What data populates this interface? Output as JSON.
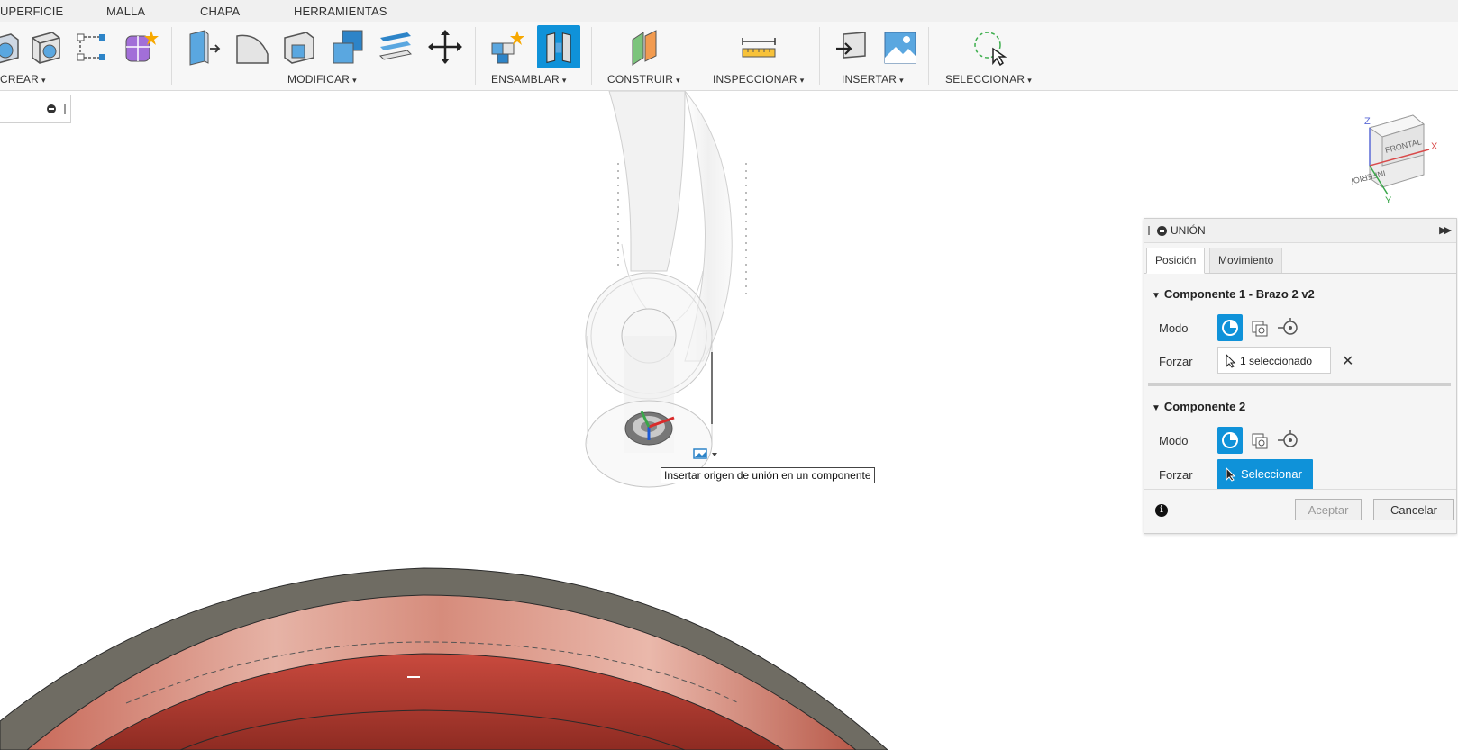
{
  "tabstrip": {
    "tabs": [
      "UPERFICIE",
      "MALLA",
      "CHAPA",
      "HERRAMIENTAS"
    ]
  },
  "toolbar": {
    "groups": [
      {
        "label": "CREAR"
      },
      {
        "label": "MODIFICAR"
      },
      {
        "label": "ENSAMBLAR"
      },
      {
        "label": "CONSTRUIR"
      },
      {
        "label": "INSPECCIONAR"
      },
      {
        "label": "INSERTAR"
      },
      {
        "label": "SELECCIONAR"
      }
    ],
    "caret": "▾",
    "icons": [
      "extrude-icon",
      "box-icon",
      "sketch-icon",
      "form-icon",
      "press-pull-icon",
      "fillet-icon",
      "shell-icon",
      "combine-icon",
      "offset-face-icon",
      "move-icon",
      "new-component-icon",
      "joint-icon",
      "plane-icon",
      "measure-icon",
      "insert-mesh-icon",
      "canvas-icon",
      "select-icon"
    ]
  },
  "viewport": {
    "tooltip": "Insertar origen de unión en un componente"
  },
  "viewcube": {
    "front": "FRONTAL",
    "bottom": "INFERIOR",
    "axis_x": "X",
    "axis_y": "Y",
    "axis_z": "Z"
  },
  "dialog": {
    "title": "UNIÓN",
    "tabs": [
      "Posición",
      "Movimiento"
    ],
    "component1": {
      "title": "Componente 1 - Brazo 2 v2",
      "mode_label": "Modo",
      "force_label": "Forzar",
      "selection": "1 seleccionado",
      "clear": "✕"
    },
    "component2": {
      "title": "Componente 2",
      "mode_label": "Modo",
      "force_label": "Forzar",
      "select_button": "Seleccionar"
    },
    "info": "i",
    "ok": "Aceptar",
    "cancel": "Cancelar"
  },
  "colors": {
    "accent": "#0f92d9",
    "part_red": "#b53a30",
    "part_gray": "#7d7a70"
  }
}
